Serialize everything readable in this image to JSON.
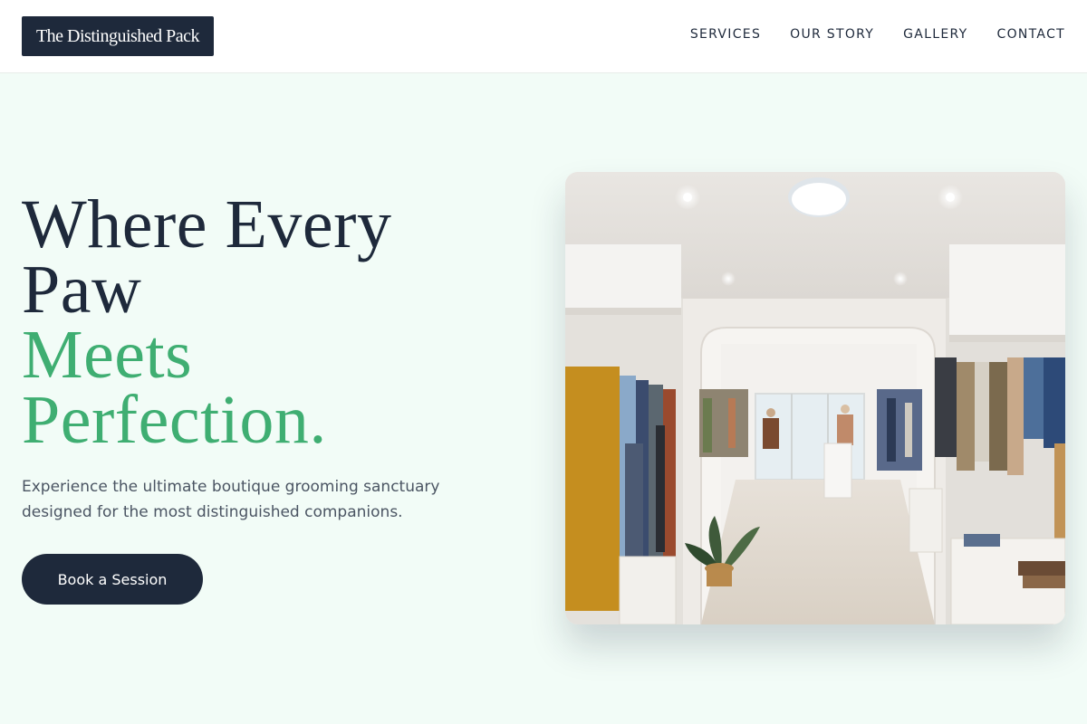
{
  "header": {
    "logo": "The Distinguished Pack",
    "nav": [
      {
        "label": "SERVICES"
      },
      {
        "label": "OUR STORY"
      },
      {
        "label": "GALLERY"
      },
      {
        "label": "CONTACT"
      }
    ]
  },
  "hero": {
    "headline_line1": "Where Every",
    "headline_line2": "Paw",
    "headline_line3": "Meets",
    "headline_line4": "Perfection.",
    "subtitle": "Experience the ultimate boutique grooming sanctuary designed for the most distinguished companions.",
    "cta_label": "Book a Session"
  },
  "colors": {
    "background": "#f2fcf7",
    "navy": "#1e293b",
    "accent_green": "#3fae72"
  },
  "image": {
    "icon": "boutique-interior-photo"
  }
}
